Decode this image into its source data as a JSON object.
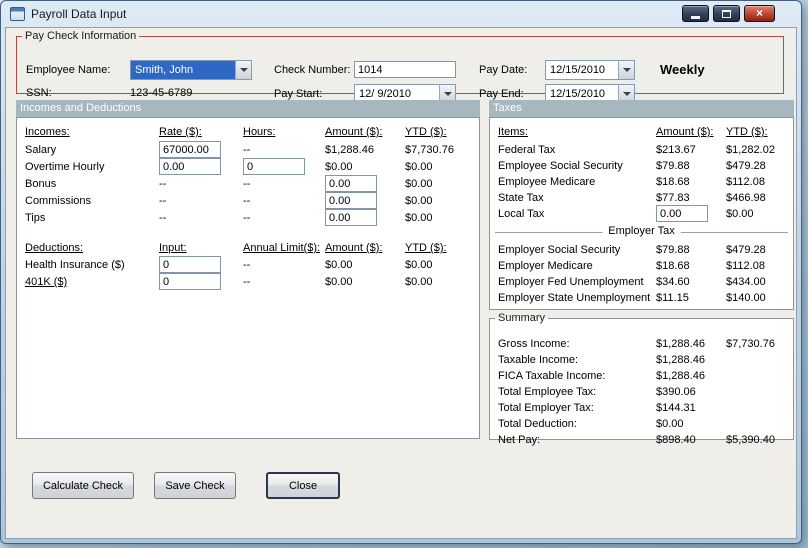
{
  "window": {
    "title": "Payroll Data Input"
  },
  "icons": {
    "close": "×"
  },
  "paycheck": {
    "legend": "Pay Check Information",
    "employee_name": {
      "label": "Employee Name:",
      "value": "Smith, John"
    },
    "ssn": {
      "label": "SSN:",
      "value": "123-45-6789"
    },
    "check_number": {
      "label": "Check Number:",
      "value": "1014"
    },
    "pay_start": {
      "label": "Pay Start:",
      "value": "12/ 9/2010"
    },
    "pay_date": {
      "label": "Pay Date:",
      "value": "12/15/2010"
    },
    "pay_end": {
      "label": "Pay End:",
      "value": "12/15/2010"
    },
    "frequency": "Weekly"
  },
  "sections": {
    "incomes_deductions": "Incomes and Deductions",
    "taxes": "Taxes"
  },
  "incomes": {
    "headers": {
      "item": "Incomes:",
      "rate": "Rate ($):",
      "hours": "Hours:",
      "amount": "Amount ($):",
      "ytd": "YTD ($):"
    },
    "rows": [
      {
        "label": "Salary",
        "rate": "67000.00",
        "hours": "--",
        "amount": "$1,288.46",
        "ytd": "$7,730.76"
      },
      {
        "label": "Overtime Hourly",
        "rate": "0.00",
        "hours": "0",
        "amount": "$0.00",
        "ytd": "$0.00"
      },
      {
        "label": "Bonus",
        "rate": "--",
        "hours": "--",
        "amount": "0.00",
        "ytd": "$0.00"
      },
      {
        "label": "Commissions",
        "rate": "--",
        "hours": "--",
        "amount": "0.00",
        "ytd": "$0.00"
      },
      {
        "label": "Tips",
        "rate": "--",
        "hours": "--",
        "amount": "0.00",
        "ytd": "$0.00"
      }
    ]
  },
  "deductions": {
    "headers": {
      "item": "Deductions:",
      "input": "Input:",
      "annual": "Annual Limit($):",
      "amount": "Amount ($):",
      "ytd": "YTD ($):"
    },
    "rows": [
      {
        "label": "Health Insurance ($)",
        "input": "0",
        "annual": "--",
        "amount": "$0.00",
        "ytd": "$0.00"
      },
      {
        "label": "401K ($)",
        "input": "0",
        "annual": "--",
        "amount": "$0.00",
        "ytd": "$0.00"
      }
    ]
  },
  "taxes": {
    "headers": {
      "item": "Items:",
      "amount": "Amount ($):",
      "ytd": "YTD ($):"
    },
    "employee_rows": [
      {
        "label": "Federal Tax",
        "amount": "$213.67",
        "ytd": "$1,282.02"
      },
      {
        "label": "Employee Social Security",
        "amount": "$79.88",
        "ytd": "$479.28"
      },
      {
        "label": "Employee Medicare",
        "amount": "$18.68",
        "ytd": "$112.08"
      },
      {
        "label": "State Tax",
        "amount": "$77.83",
        "ytd": "$466.98"
      },
      {
        "label": "Local Tax",
        "amount": "0.00",
        "ytd": "$0.00"
      }
    ],
    "employer_header": "Employer Tax",
    "employer_rows": [
      {
        "label": "Employer Social Security",
        "amount": "$79.88",
        "ytd": "$479.28"
      },
      {
        "label": "Employer Medicare",
        "amount": "$18.68",
        "ytd": "$112.08"
      },
      {
        "label": "Employer Fed Unemployment",
        "amount": "$34.60",
        "ytd": "$434.00"
      },
      {
        "label": "Employer State Unemployment",
        "amount": "$11.15",
        "ytd": "$140.00"
      }
    ]
  },
  "summary": {
    "legend": "Summary",
    "rows": [
      {
        "label": "Gross Income:",
        "value": "$1,288.46",
        "ytd": "$7,730.76"
      },
      {
        "label": "Taxable Income:",
        "value": "$1,288.46",
        "ytd": ""
      },
      {
        "label": "FICA Taxable Income:",
        "value": "$1,288.46",
        "ytd": ""
      },
      {
        "label": "Total Employee Tax:",
        "value": "$390.06",
        "ytd": ""
      },
      {
        "label": "Total Employer Tax:",
        "value": "$144.31",
        "ytd": ""
      },
      {
        "label": "Total Deduction:",
        "value": "$0.00",
        "ytd": ""
      },
      {
        "label": "Net Pay:",
        "value": "$898.40",
        "ytd": "$5,390.40"
      }
    ]
  },
  "buttons": {
    "calculate": "Calculate Check",
    "save": "Save Check",
    "close": "Close"
  }
}
